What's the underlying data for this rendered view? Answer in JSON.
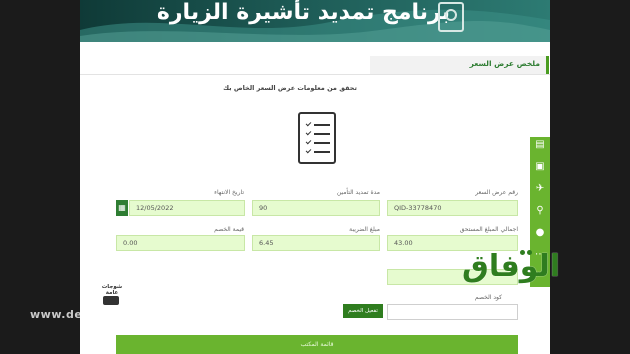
{
  "banner": {
    "title": "برنامج تمديد تأشيرة الزيارة"
  },
  "section": {
    "title": "ملخص عرض السعر"
  },
  "instruction": "تحقق من معلومات عرض السعر الخاص بك",
  "fields": {
    "quote_number": {
      "label": "رقم عرض السعر",
      "value": "QID-33778470"
    },
    "insurance_period": {
      "label": "مدة تمديد التأمين",
      "value": "90"
    },
    "expiry_date": {
      "label": "تاريخ الانتهاء",
      "value": "12/05/2022"
    },
    "total_due": {
      "label": "اجمالي المبلغ المستحق",
      "value": "43.00"
    },
    "tax_amount": {
      "label": "مبلغ الضريبة",
      "value": "6.45"
    },
    "discount_value": {
      "label": "قيمة الخصم",
      "value": "0.00"
    },
    "discount_code": {
      "label": "كود الخصم",
      "value": ""
    }
  },
  "buttons": {
    "apply_discount": "تفعيل الخصم"
  },
  "bottom_bar": {
    "label": "قائمة المكتب"
  },
  "offers": {
    "label": "شوجات عامة"
  },
  "watermark": {
    "url": "www.de",
    "logo": "الوفاق"
  },
  "toolbar_icons": [
    "document-icon",
    "print-icon",
    "plane-icon",
    "search-icon",
    "person-icon",
    "more-icon"
  ],
  "colors": {
    "accent": "#6ab42f",
    "field_bg": "#e6fbcf",
    "banner": "#1d5a55",
    "title_green": "#2e7d32"
  }
}
